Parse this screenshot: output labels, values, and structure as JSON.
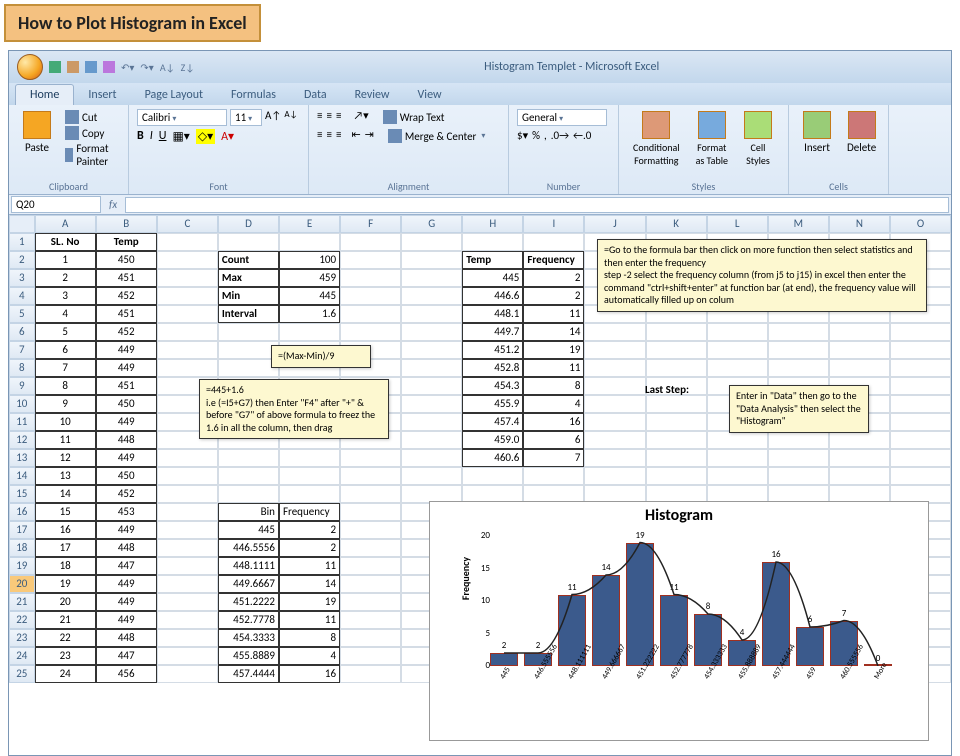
{
  "page_title": "How to Plot Histogram in Excel",
  "window_title": "Histogram Templet - Microsoft Excel",
  "tabs": [
    "Home",
    "Insert",
    "Page Layout",
    "Formulas",
    "Data",
    "Review",
    "View"
  ],
  "active_tab": "Home",
  "ribbon": {
    "clipboard": {
      "label": "Clipboard",
      "paste": "Paste",
      "cut": "Cut",
      "copy": "Copy",
      "format_painter": "Format Painter"
    },
    "font": {
      "label": "Font",
      "name": "Calibri",
      "size": "11"
    },
    "alignment": {
      "label": "Alignment",
      "wrap": "Wrap Text",
      "merge": "Merge & Center"
    },
    "number": {
      "label": "Number",
      "format": "General"
    },
    "styles": {
      "label": "Styles",
      "cond": "Conditional\nFormatting",
      "table": "Format\nas Table",
      "cell": "Cell\nStyles"
    },
    "cells": {
      "label": "Cells",
      "insert": "Insert",
      "delete": "Delete"
    }
  },
  "name_box": "Q20",
  "formula_value": "",
  "columns": [
    "A",
    "B",
    "C",
    "D",
    "E",
    "F",
    "G",
    "H",
    "I",
    "J",
    "K",
    "L",
    "M",
    "N",
    "O"
  ],
  "data_rows": [
    {
      "r": 1,
      "A": "SL. No",
      "B": "Temp",
      "Ab": true,
      "Bb": true
    },
    {
      "r": 2,
      "A": "1",
      "B": "450",
      "D": "Count",
      "E": "100",
      "H": "Temp",
      "I": "Frequency",
      "Db": true,
      "Hb": true,
      "Ib": true
    },
    {
      "r": 3,
      "A": "2",
      "B": "451",
      "D": "Max",
      "E": "459",
      "H": "445",
      "I": "2",
      "Db": true
    },
    {
      "r": 4,
      "A": "3",
      "B": "452",
      "D": "Min",
      "E": "445",
      "H": "446.6",
      "I": "2",
      "Db": true
    },
    {
      "r": 5,
      "A": "4",
      "B": "451",
      "D": "Interval",
      "E": "1.6",
      "H": "448.1",
      "I": "11",
      "Db": true
    },
    {
      "r": 6,
      "A": "5",
      "B": "452",
      "H": "449.7",
      "I": "14"
    },
    {
      "r": 7,
      "A": "6",
      "B": "449",
      "H": "451.2",
      "I": "19"
    },
    {
      "r": 8,
      "A": "7",
      "B": "449",
      "H": "452.8",
      "I": "11"
    },
    {
      "r": 9,
      "A": "8",
      "B": "451",
      "H": "454.3",
      "I": "8"
    },
    {
      "r": 10,
      "A": "9",
      "B": "450",
      "H": "455.9",
      "I": "4"
    },
    {
      "r": 11,
      "A": "10",
      "B": "449",
      "H": "457.4",
      "I": "16"
    },
    {
      "r": 12,
      "A": "11",
      "B": "448",
      "H": "459.0",
      "I": "6"
    },
    {
      "r": 13,
      "A": "12",
      "B": "449",
      "H": "460.6",
      "I": "7"
    },
    {
      "r": 14,
      "A": "13",
      "B": "450"
    },
    {
      "r": 15,
      "A": "14",
      "B": "452"
    },
    {
      "r": 16,
      "A": "15",
      "B": "453",
      "D": "Bin",
      "E": "Frequency",
      "Di": true,
      "Ei": true
    },
    {
      "r": 17,
      "A": "16",
      "B": "449",
      "D": "445",
      "E": "2"
    },
    {
      "r": 18,
      "A": "17",
      "B": "448",
      "D": "446.5556",
      "E": "2"
    },
    {
      "r": 19,
      "A": "18",
      "B": "447",
      "D": "448.1111",
      "E": "11"
    },
    {
      "r": 20,
      "A": "19",
      "B": "449",
      "D": "449.6667",
      "E": "14"
    },
    {
      "r": 21,
      "A": "20",
      "B": "449",
      "D": "451.2222",
      "E": "19"
    },
    {
      "r": 22,
      "A": "21",
      "B": "449",
      "D": "452.7778",
      "E": "11"
    },
    {
      "r": 23,
      "A": "22",
      "B": "448",
      "D": "454.3333",
      "E": "8"
    },
    {
      "r": 24,
      "A": "23",
      "B": "447",
      "D": "455.8889",
      "E": "4"
    },
    {
      "r": 25,
      "A": "24",
      "B": "456",
      "D": "457.4444",
      "E": "16"
    }
  ],
  "callout1": "=(Max-Min)/9",
  "callout2": "=445+1.6\ni.e (=I5+G7) then Enter \"F4\" after \"+\" & before \"G7\" of above formula to freez the 1.6 in all the column, then drag",
  "callout3": "=Go to the formula bar then click on more function then select statistics and then enter the frequency\nstep -2 select the frequency column (from j5 to j15) in excel then enter the command \"ctrl+shift+enter\" at function bar (at end), the frequency value will automatically filled up on colum",
  "callout4_label": "Last Step:",
  "callout4": "Enter in \"Data\" then go to the \"Data Analysis\" then select the \"Histogram\"",
  "chart_data": {
    "type": "bar",
    "title": "Histogram",
    "ylabel": "Frequency",
    "xlabel": "",
    "ylim": [
      0,
      20
    ],
    "yticks": [
      0,
      5,
      10,
      15,
      20
    ],
    "categories": [
      "445",
      "446.555556",
      "448.111111",
      "449.666667",
      "451.222222",
      "452.777778",
      "454.333333",
      "455.888889",
      "457.444444",
      "459",
      "460.555556",
      "More"
    ],
    "values": [
      2,
      2,
      11,
      14,
      19,
      11,
      8,
      4,
      16,
      6,
      7,
      0
    ]
  }
}
